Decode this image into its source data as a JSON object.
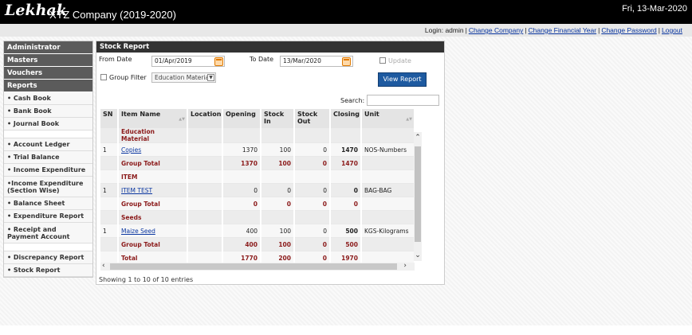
{
  "app": {
    "logo": "Lekhak",
    "company": "XYZ Company (2019-2020)",
    "date": "Fri, 13-Mar-2020"
  },
  "topnav": {
    "login": "Login: admin",
    "change_company": "Change Company",
    "change_fy": "Change Financial Year",
    "change_password": "Change Password",
    "logout": "Logout"
  },
  "sidebar": {
    "sections": [
      "Administrator",
      "Masters",
      "Vouchers",
      "Reports"
    ],
    "items": [
      "• Cash Book",
      "• Bank Book",
      "• Journal Book",
      "• Account Ledger",
      "• Trial Balance",
      "• Income Expenditure",
      "•Income Expenditure (Section Wise)",
      "• Balance Sheet",
      "• Expenditure Report",
      "• Receipt and Payment Account",
      "• Discrepancy Report",
      "• Stock Report"
    ]
  },
  "panel": {
    "title": "Stock Report",
    "from_label": "From Date",
    "from_value": "01/Apr/2019",
    "to_label": "To Date",
    "to_value": "13/Mar/2020",
    "update_label": "Update",
    "group_filter_label": "Group Filter",
    "group_filter_value": "Education Material",
    "view_button": "View Report",
    "search_label": "Search:",
    "search_value": "",
    "columns": [
      "SN",
      "Item Name",
      "Location",
      "Opening",
      "Stock In",
      "Stock Out",
      "Closing",
      "Unit"
    ],
    "rows": [
      {
        "sn": "",
        "item": "Education Material",
        "loc": "",
        "open": "",
        "in": "",
        "out": "",
        "close": "",
        "unit": "",
        "type": "group"
      },
      {
        "sn": "1",
        "item": "Copies",
        "loc": "",
        "open": "1370",
        "in": "100",
        "out": "0",
        "close": "1470",
        "unit": "NOS-Numbers",
        "type": "item"
      },
      {
        "sn": "",
        "item": "Group Total",
        "loc": "",
        "open": "1370",
        "in": "100",
        "out": "0",
        "close": "1470",
        "unit": "",
        "type": "total"
      },
      {
        "sn": "",
        "item": "ITEM",
        "loc": "",
        "open": "",
        "in": "",
        "out": "",
        "close": "",
        "unit": "",
        "type": "group"
      },
      {
        "sn": "1",
        "item": "ITEM TEST",
        "loc": "",
        "open": "0",
        "in": "0",
        "out": "0",
        "close": "0",
        "unit": "BAG-BAG",
        "type": "item"
      },
      {
        "sn": "",
        "item": "Group Total",
        "loc": "",
        "open": "0",
        "in": "0",
        "out": "0",
        "close": "0",
        "unit": "",
        "type": "total"
      },
      {
        "sn": "",
        "item": "Seeds",
        "loc": "",
        "open": "",
        "in": "",
        "out": "",
        "close": "",
        "unit": "",
        "type": "group"
      },
      {
        "sn": "1",
        "item": "Maize Seed",
        "loc": "",
        "open": "400",
        "in": "100",
        "out": "0",
        "close": "500",
        "unit": "KGS-Kilograms",
        "type": "item"
      },
      {
        "sn": "",
        "item": "Group Total",
        "loc": "",
        "open": "400",
        "in": "100",
        "out": "0",
        "close": "500",
        "unit": "",
        "type": "total"
      },
      {
        "sn": "",
        "item": "Total",
        "loc": "",
        "open": "1770",
        "in": "200",
        "out": "0",
        "close": "1970",
        "unit": "",
        "type": "total"
      }
    ],
    "info": "Showing 1 to 10 of 10 entries"
  }
}
